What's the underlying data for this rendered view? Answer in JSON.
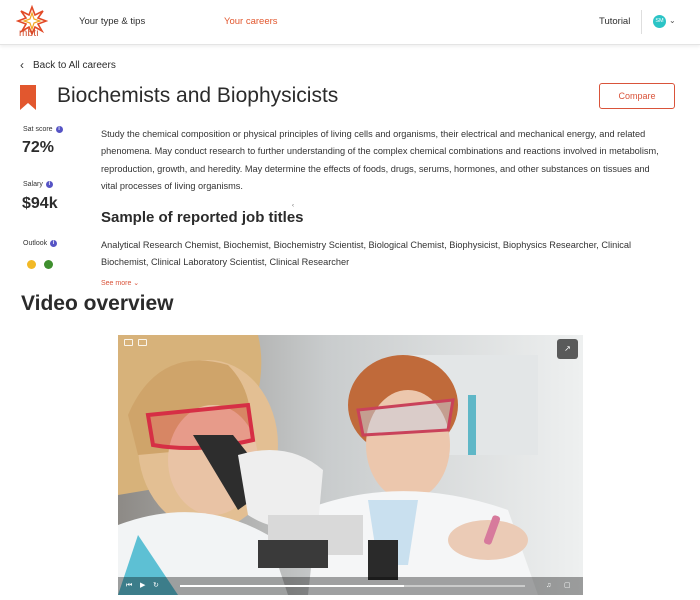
{
  "nav": {
    "logo_text": "mbti",
    "links": [
      {
        "label": "Your type & tips",
        "active": false
      },
      {
        "label": "Your careers",
        "active": true
      }
    ],
    "tutorial": "Tutorial",
    "avatar_initials": "SM"
  },
  "back_link": "Back to All careers",
  "career": {
    "title": "Biochemists and Biophysicists",
    "compare_label": "Compare",
    "stats": {
      "sat_label": "Sat score",
      "sat_value": "72%",
      "salary_label": "Salary",
      "salary_value": "$94k",
      "outlook_label": "Outlook"
    },
    "description": "Study the chemical composition or physical principles of living cells and organisms, their electrical and mechanical energy, and related phenomena. May conduct research to further understanding of the complex chemical combinations and reactions involved in metabolism, reproduction, growth, and heredity. May determine the effects of foods, drugs, serums, hormones, and other substances on tissues and vital processes of living organisms.",
    "job_titles_heading": "Sample of reported job titles",
    "job_titles": "Analytical Research Chemist, Biochemist, Biochemistry Scientist, Biological Chemist, Biophysicist, Biophysics Researcher, Clinical Biochemist, Clinical Laboratory Scientist, Clinical Researcher",
    "see_more": "See more"
  },
  "video": {
    "heading": "Video overview",
    "progress": 0.65
  },
  "colors": {
    "accent": "#e2572e",
    "info": "#5654c5",
    "avatar": "#2bc4c6"
  }
}
